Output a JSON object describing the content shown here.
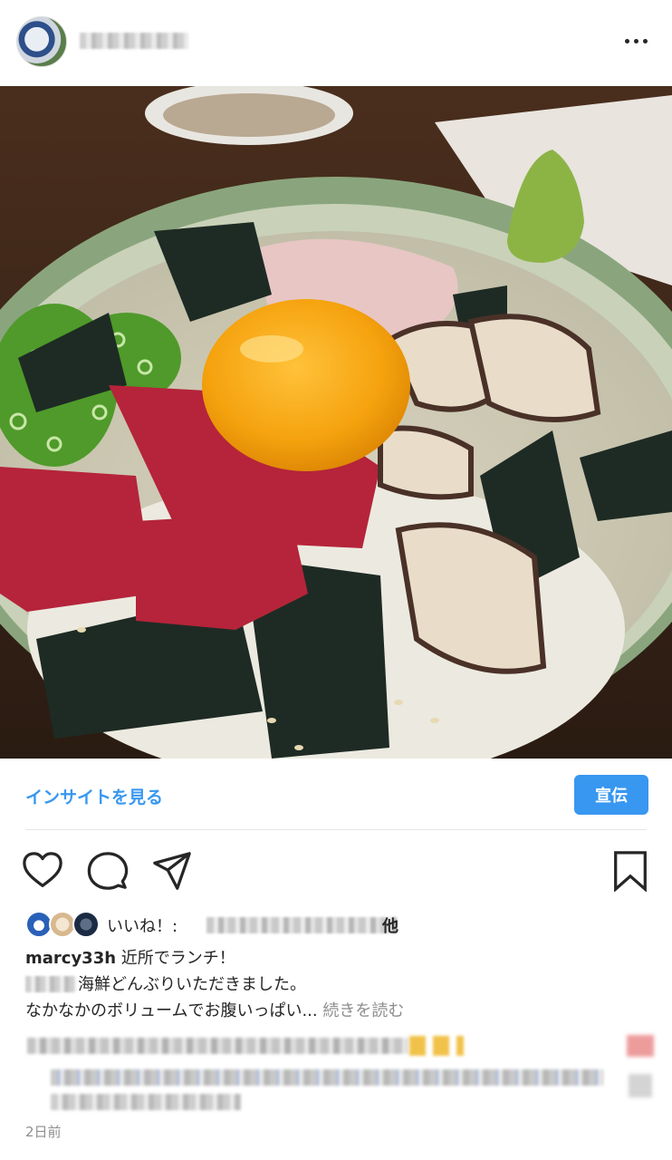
{
  "post": {
    "insight_label": "インサイトを見る",
    "promote_label": "宣伝",
    "likes": {
      "prefix": "いいね！:",
      "others": "他"
    },
    "caption": {
      "username": "marcy33h",
      "line1": "近所でランチ！",
      "line2": "海鮮どんぶりいただきました。",
      "line3": "なかなかのボリュームでお腹いっぱい...",
      "more_label": "続きを読む"
    },
    "timestamp": "2日前"
  },
  "icons": {
    "more": "more-horizontal-icon",
    "like": "heart-outline-icon",
    "comment": "comment-bubble-icon",
    "share": "paper-plane-icon",
    "save": "bookmark-outline-icon"
  },
  "colors": {
    "accent": "#3897f0",
    "text": "#262626",
    "muted": "#8e8e8e"
  }
}
